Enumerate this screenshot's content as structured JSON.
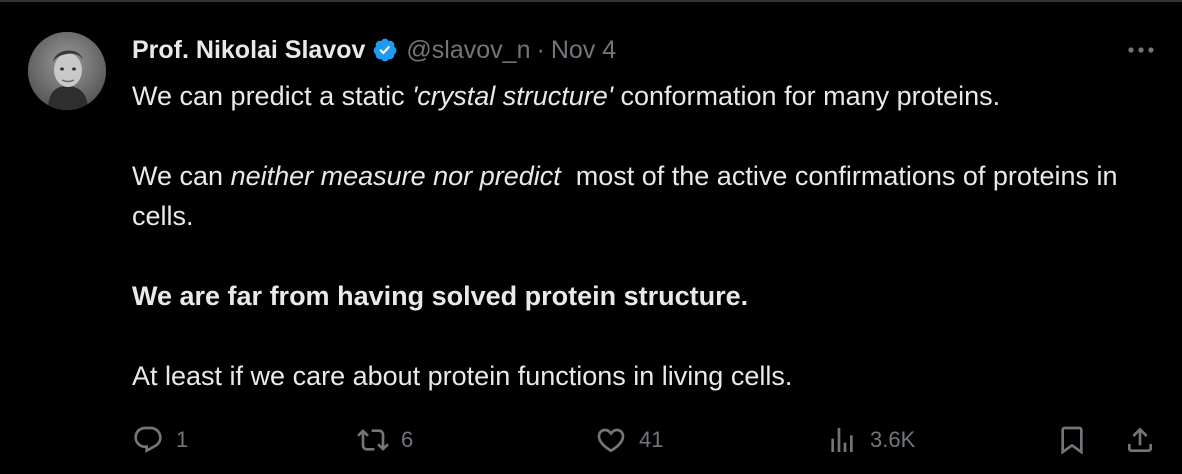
{
  "tweet": {
    "author": {
      "name": "Prof. Nikolai Slavov",
      "handle": "@slavov_n",
      "verified": true,
      "verified_color": "#1d9bf0",
      "avatar_icon": "avatar-photo-icon"
    },
    "separator": "·",
    "date": "Nov 4",
    "more_icon": "more-horizontal-icon",
    "paragraphs": {
      "p1": {
        "a": "We can predict a static ",
        "b": "'crystal structure'",
        "c": " conformation for many proteins."
      },
      "p2": {
        "a": "We can ",
        "b": "neither measure nor predict",
        "c": "  most of the active confirmations of proteins in cells."
      },
      "p3": "We are far from having solved protein structure.",
      "p4": "At least if we care about protein functions in living cells."
    },
    "actions": {
      "reply": {
        "icon": "reply-icon",
        "count": "1"
      },
      "retweet": {
        "icon": "retweet-icon",
        "count": "6"
      },
      "like": {
        "icon": "heart-icon",
        "count": "41"
      },
      "views": {
        "icon": "analytics-icon",
        "count": "3.6K"
      },
      "bookmark": {
        "icon": "bookmark-icon"
      },
      "share": {
        "icon": "share-icon"
      }
    }
  },
  "colors": {
    "background": "#000000",
    "text": "#e7e9ea",
    "muted": "#71767b",
    "border": "#2f3336",
    "accent": "#1d9bf0"
  }
}
